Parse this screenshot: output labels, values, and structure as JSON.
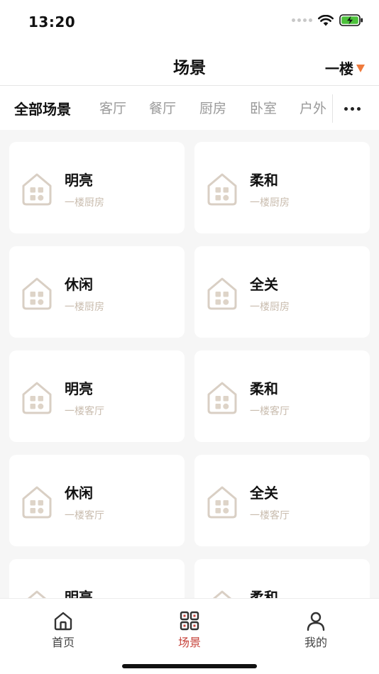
{
  "status_bar": {
    "time": "13:20"
  },
  "header": {
    "title": "场景",
    "floor": "一楼"
  },
  "tabs": [
    {
      "label": "全部场景",
      "active": true
    },
    {
      "label": "客厅",
      "active": false
    },
    {
      "label": "餐厅",
      "active": false
    },
    {
      "label": "厨房",
      "active": false
    },
    {
      "label": "卧室",
      "active": false
    },
    {
      "label": "户外",
      "active": false
    }
  ],
  "scenes": [
    {
      "name": "明亮",
      "room": "一楼厨房"
    },
    {
      "name": "柔和",
      "room": "一楼厨房"
    },
    {
      "name": "休闲",
      "room": "一楼厨房"
    },
    {
      "name": "全关",
      "room": "一楼厨房"
    },
    {
      "name": "明亮",
      "room": "一楼客厅"
    },
    {
      "name": "柔和",
      "room": "一楼客厅"
    },
    {
      "name": "休闲",
      "room": "一楼客厅"
    },
    {
      "name": "全关",
      "room": "一楼客厅"
    },
    {
      "name": "明亮",
      "room": ""
    },
    {
      "name": "柔和",
      "room": ""
    }
  ],
  "tabbar": [
    {
      "label": "首页",
      "icon": "home-icon",
      "active": false
    },
    {
      "label": "场景",
      "icon": "grid-icon",
      "active": true
    },
    {
      "label": "我的",
      "icon": "user-icon",
      "active": false
    }
  ],
  "colors": {
    "accent": "#c6423a",
    "caret": "#ef7a3c",
    "icon_tint": "#d9cfc4",
    "icon_cell": "#ded4c8",
    "room_text": "#c9bcae",
    "battery": "#4cc13b"
  }
}
